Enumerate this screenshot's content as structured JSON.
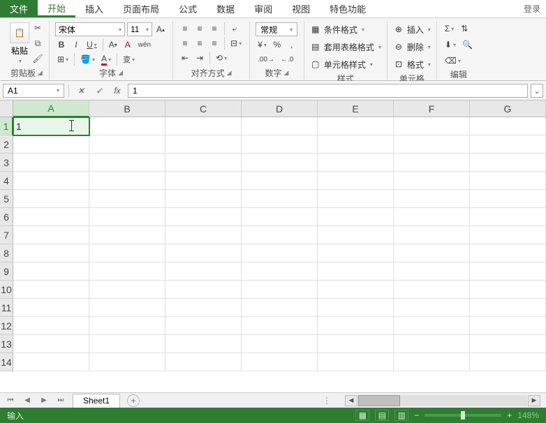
{
  "menu": {
    "file": "文件",
    "tabs": [
      "开始",
      "插入",
      "页面布局",
      "公式",
      "数据",
      "审阅",
      "视图",
      "特色功能"
    ],
    "active": 0,
    "login": "登录"
  },
  "ribbon": {
    "clipboard": {
      "paste": "粘贴",
      "label": "剪贴板"
    },
    "font": {
      "name": "宋体",
      "size": "11",
      "label": "字体"
    },
    "align": {
      "label": "对齐方式"
    },
    "number": {
      "format": "常规",
      "label": "数字"
    },
    "styles": {
      "cond": "条件格式",
      "table": "套用表格格式",
      "cell": "单元格样式",
      "label": "样式"
    },
    "cells": {
      "insert": "插入",
      "delete": "删除",
      "format": "格式",
      "label": "单元格"
    },
    "edit": {
      "label": "编辑"
    }
  },
  "namebox": "A1",
  "formula": "1",
  "columns": [
    "A",
    "B",
    "C",
    "D",
    "E",
    "F",
    "G"
  ],
  "rows": [
    1,
    2,
    3,
    4,
    5,
    6,
    7,
    8,
    9,
    10,
    11,
    12,
    13,
    14
  ],
  "active_cell": {
    "row": 1,
    "col": "A",
    "value": "1"
  },
  "sheets": {
    "active": "Sheet1"
  },
  "status": {
    "mode": "输入",
    "zoom": "148%"
  }
}
